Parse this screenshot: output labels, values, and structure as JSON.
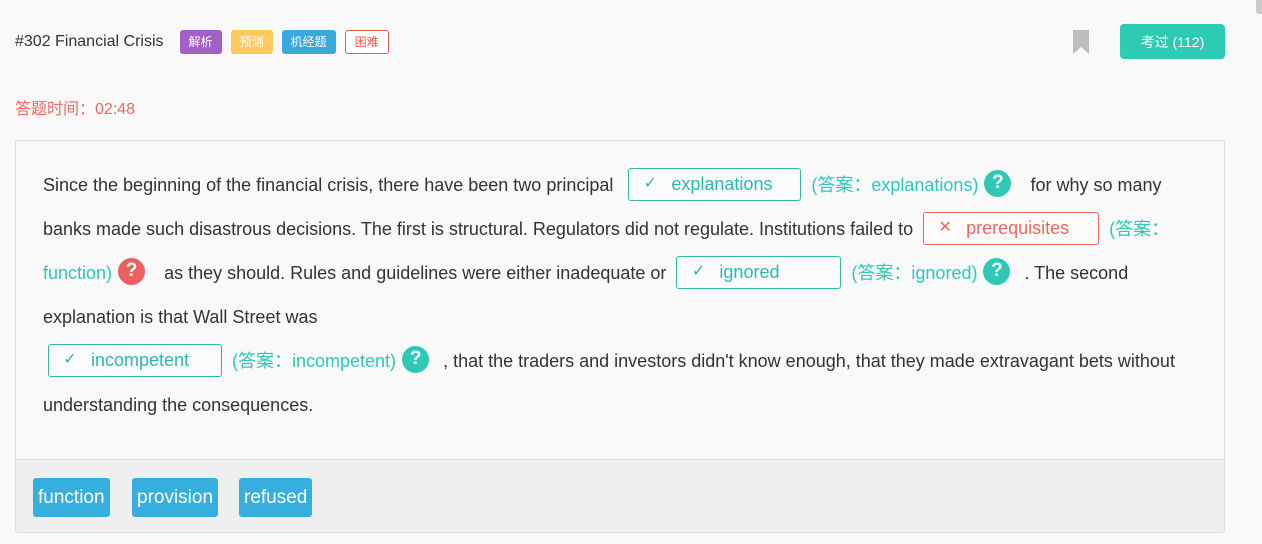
{
  "question": {
    "title": "#302 Financial Crisis",
    "tags": [
      {
        "label": "解析",
        "color": "#a35fc7"
      },
      {
        "label": "预测",
        "color": "#ffc95c"
      },
      {
        "label": "机经题",
        "color": "#3aa9dc"
      },
      {
        "label": "困难",
        "color": "#e85a50"
      }
    ],
    "exam_button_label": "考过 (112)"
  },
  "timer": {
    "label": "答题时间：",
    "value": "02:48"
  },
  "passage": {
    "segments": [
      "Since the beginning of the financial crisis, there have been two principal",
      "for why so many banks made such disastrous decisions. The first is structural. Regulators did not regulate. Institutions failed to",
      "as they should. Rules and guidelines were either inadequate or",
      ". The second explanation is that Wall Street was",
      ", that the traders and investors didn't know enough, that they made extravagant bets without understanding the consequences."
    ],
    "blanks": [
      {
        "mark": "✓",
        "user_answer": "explanations",
        "answer_label": "(答案：explanations)",
        "correct": "true"
      },
      {
        "mark": "✕",
        "user_answer": "prerequisites",
        "answer_label": "(答案：function)",
        "correct": "false"
      },
      {
        "mark": "✓",
        "user_answer": "ignored",
        "answer_label": "(答案：ignored)",
        "correct": "true"
      },
      {
        "mark": "✓",
        "user_answer": "incompetent",
        "answer_label": "(答案：incompetent)",
        "correct": "true"
      }
    ],
    "help_icon": "?"
  },
  "options": [
    "function",
    "provision",
    "refused"
  ],
  "colors": {
    "accent": "#2dcab4",
    "correct": "#2fb9ad",
    "wrong": "#e86a63",
    "option_bg": "#36aede",
    "timer": "#e96a5f"
  },
  "icons": {
    "bookmark": "bookmark-icon",
    "help": "help-circle-icon",
    "check": "check-icon",
    "cross": "cross-icon"
  }
}
